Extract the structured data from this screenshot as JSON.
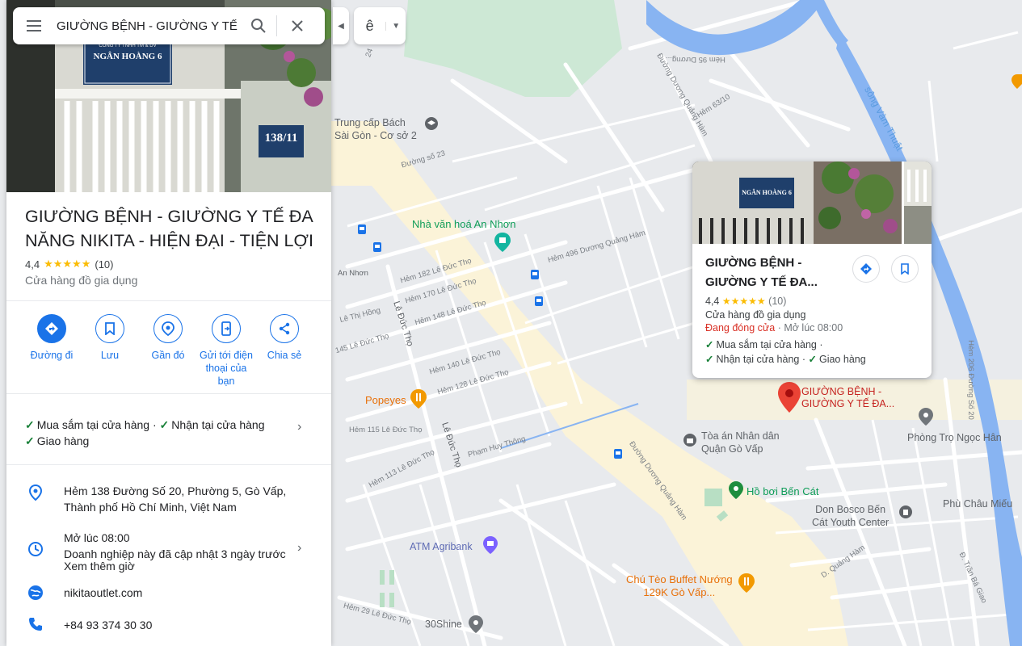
{
  "search": {
    "query": "GIƯỜNG BỆNH - GIƯỜNG Y TẾ ĐA NĂNG NIKITA - HIỆN ĐẠI - TIỆN LỢI"
  },
  "lang": {
    "char": "ê"
  },
  "place": {
    "title": "GIƯỜNG BỆNH - GIƯỜNG Y TẾ ĐA NĂNG NIKITA - HIỆN ĐẠI - TIỆN LỢI",
    "rating": "4,4",
    "stars": "★★★★★",
    "reviews": "(10)",
    "category": "Cửa hàng đồ gia dụng",
    "actions": [
      {
        "label": "Đường đi",
        "icon": "directions-icon"
      },
      {
        "label": "Lưu",
        "icon": "bookmark-icon"
      },
      {
        "label": "Gần đó",
        "icon": "nearby-icon"
      },
      {
        "label": "Gửi tới điện thoại của bạn",
        "icon": "send-to-phone-icon"
      },
      {
        "label": "Chia sẻ",
        "icon": "share-icon"
      }
    ],
    "features": {
      "f1": "Mua sắm tại cửa hàng ·",
      "f2": "Nhận tại cửa hàng",
      "f3": "Giao hàng"
    },
    "address": "Hẻm 138 Đường Số 20, Phường 5, Gò Vấp, Thành phố Hồ Chí Minh, Việt Nam",
    "hours": {
      "main": "Mở lúc 08:00",
      "note": "Doanh nghiệp này đã cập nhật 3 ngày trước",
      "more": "Xem thêm giờ"
    },
    "website": "nikitaoutlet.com",
    "phone": "+84 93 374 30 30"
  },
  "photo": {
    "sign_line1": "CÔNG TY TNHH TM & DV",
    "sign_name": "NGÂN HOÀNG 6",
    "house_number": "138/11"
  },
  "card": {
    "title": "GIƯỜNG BỆNH - GIƯỜNG Y TẾ ĐA...",
    "rating": "4,4",
    "stars": "★★★★★",
    "reviews": "(10)",
    "category": "Cửa hàng đồ gia dụng",
    "status": "Đang đóng cửa",
    "open_time": "· Mở lúc 08:00",
    "f1": "Mua sắm tại cửa hàng ·",
    "f2": "Nhận tại cửa hàng ·",
    "f3": "Giao hàng"
  },
  "map_labels": {
    "school": "Trung cấp Bách\nSài Gòn - Cơ sở 2",
    "culture_house": "Nhà văn hoá An Nhơn",
    "popeyes": "Popeyes",
    "court": "Tòa án Nhân dân\nQuận Gò Vấp",
    "pool": "Hồ bơi Bến Cát",
    "donbosco": "Don Bosco Bến\nCát Youth Center",
    "atm": "ATM Agribank",
    "buffet": "Chú Tèo Buffet Nướng\n129K Gò Vấp...",
    "shine": "30Shine",
    "phongtro": "Phòng Trọ Ngọc Hân",
    "phuchau": "Phù Châu Miếu",
    "marker": "GIƯỜNG BỆNH -\nGIƯỜNG Y TẾ ĐA...",
    "river": "sông Vàm Thuật",
    "s_annhon": "An Nhơn",
    "s_lethihong": "Lê Thị Hồng",
    "s_leductho": "Lê Đức Thọ",
    "s_leductho2": "Lê Đức Thọ",
    "s_182": "Hẻm 182 Lê Đức Thọ",
    "s_170": "Hẻm 170 Lê Đức Thọ",
    "s_148": "Hẻm 148 Lê Đức Thọ",
    "s_145": "145 Lê Đức Thọ",
    "s_140": "Hẻm 140 Lê Đức Thọ",
    "s_128": "Hẻm 128 Lê Đức Thọ",
    "s_115": "Hẻm 115 Lê Đức Thọ",
    "s_113": "Hẻm 113 Lê Đức Thọ",
    "s_29": "Hẻm 29 Lê Đức Thọ",
    "s_phamhuythong": "Phạm Huy Thông",
    "s_496": "Hẻm 496 Dương Quảng Hàm",
    "s_duong23": "Đường số 23",
    "s_dqh": "Đường Dương Quảng Hàm",
    "s_dqh2": "Đường Dương Quảng Hàm",
    "s_63": "Hẻm 63/10",
    "s_hem95": "Hẻm 95 Dương...",
    "s_206": "Hẻm 206 Đường Số 20",
    "s_dqh3": "D. Quảng Hàm",
    "s_tranbagiao": "Đ. Trần Bá Giao",
    "s_24": "24"
  },
  "colors": {
    "accent": "#1a73e8",
    "closed": "#d93025",
    "check": "#188038",
    "star": "#fbbc04"
  }
}
